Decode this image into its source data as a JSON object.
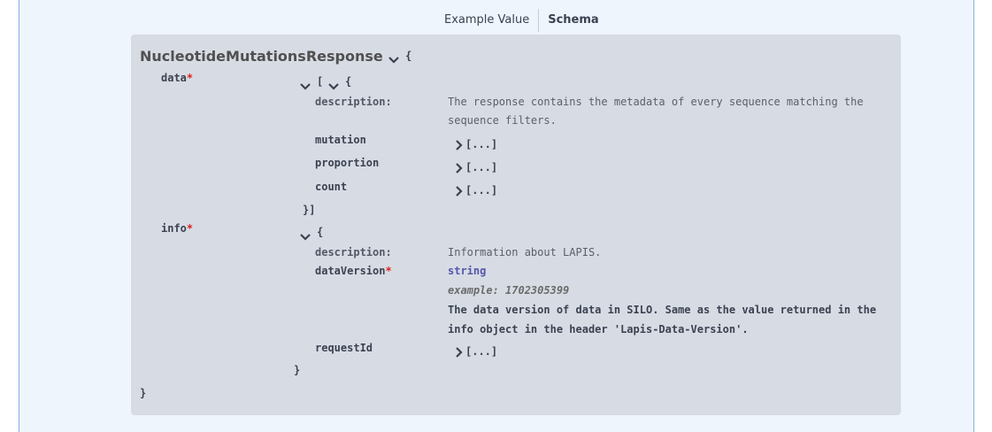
{
  "tabs": {
    "example_value": "Example Value",
    "schema": "Schema"
  },
  "model": {
    "name": "NucleotideMutationsResponse",
    "open_brace": "{",
    "close_brace": "}",
    "required_mark": "*",
    "data": {
      "name": "data",
      "open": "[",
      "open_obj": "{",
      "close": "}]",
      "description_key": "description:",
      "description": "The response contains the metadata of every sequence matching the sequence filters.",
      "fields": [
        {
          "name": "mutation",
          "collapsed": "[...]"
        },
        {
          "name": "proportion",
          "collapsed": "[...]"
        },
        {
          "name": "count",
          "collapsed": "[...]"
        }
      ]
    },
    "info": {
      "name": "info",
      "open": "{",
      "close": "}",
      "description_key": "description:",
      "description": "Information about LAPIS.",
      "dataVersion": {
        "name": "dataVersion",
        "type": "string",
        "example": "example: 1702305399",
        "description": "The data version of data in SILO. Same as the value returned in the info object in the header 'Lapis-Data-Version'."
      },
      "requestId": {
        "name": "requestId",
        "collapsed": "[...]"
      }
    }
  }
}
